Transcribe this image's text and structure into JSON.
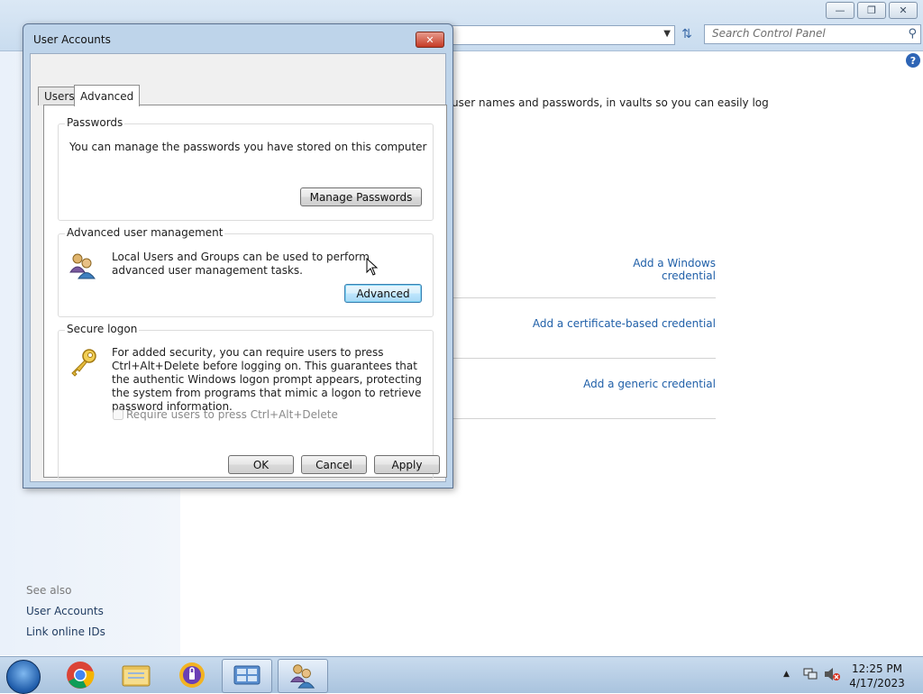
{
  "control_panel": {
    "search_placeholder": "Search Control Panel",
    "description_fragment": "user names and passwords, in vaults so you can easily log",
    "credential_links": [
      "Add a Windows credential",
      "Add a certificate-based credential",
      "Add a generic credential"
    ],
    "see_also_heading": "See also",
    "see_also_links": [
      "User Accounts",
      "Link online IDs"
    ]
  },
  "dialog": {
    "title": "User Accounts",
    "tabs": [
      "Users",
      "Advanced"
    ],
    "active_tab": "Advanced",
    "passwords": {
      "title": "Passwords",
      "text": "You can manage the passwords you have stored on this computer",
      "button": "Manage Passwords"
    },
    "advanced_mgmt": {
      "title": "Advanced user management",
      "text": "Local Users and Groups can be used to perform advanced user management tasks.",
      "button": "Advanced"
    },
    "secure_logon": {
      "title": "Secure logon",
      "text": "For added security, you can require users to press Ctrl+Alt+Delete before logging on. This guarantees that the authentic Windows logon prompt appears, protecting the system from programs that mimic a logon to retrieve password information.",
      "checkbox_label": "Require users to press Ctrl+Alt+Delete",
      "checkbox_checked": false,
      "checkbox_enabled": false
    },
    "buttons": {
      "ok": "OK",
      "cancel": "Cancel",
      "apply": "Apply"
    }
  },
  "taskbar": {
    "apps": [
      "start-orb",
      "chrome",
      "file-explorer",
      "password-manager",
      "control-panel",
      "user-accounts"
    ],
    "clock_time": "12:25 PM",
    "clock_date": "4/17/2023"
  }
}
